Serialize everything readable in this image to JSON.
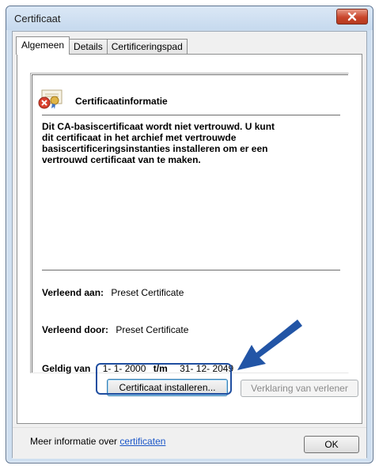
{
  "window": {
    "title": "Certificaat"
  },
  "tabs": [
    "Algemeen",
    "Details",
    "Certificeringspad"
  ],
  "info": {
    "title": "Certificaatinformatie",
    "warning_lines": [
      "Dit CA-basiscertificaat wordt niet vertrouwd. U kunt",
      "dit certificaat in het archief met vertrouwde",
      "basiscertificeringsinstanties installeren om er een",
      "vertrouwd certificaat van te maken."
    ],
    "issued_to_label": "Verleend aan:",
    "issued_to_value": "Preset Certificate",
    "issued_by_label": "Verleend door:",
    "issued_by_value": "Preset Certificate",
    "valid_from_label": "Geldig van",
    "valid_from_value": "1- 1- 2000",
    "valid_to_label": "t/m",
    "valid_to_value": "31- 12- 2049"
  },
  "buttons": {
    "install": "Certificaat installeren...",
    "issuer_statement": "Verklaring van verlener",
    "ok": "OK"
  },
  "footer": {
    "more_info_prefix": "Meer informatie over",
    "more_info_link": "certificaten"
  },
  "colors": {
    "accent_arrow": "#2255a6",
    "highlight_border": "#1f4ea0",
    "close_button": "#c9462c"
  },
  "icons": {
    "close": "close-icon",
    "cert": "certificate-warning-icon"
  }
}
